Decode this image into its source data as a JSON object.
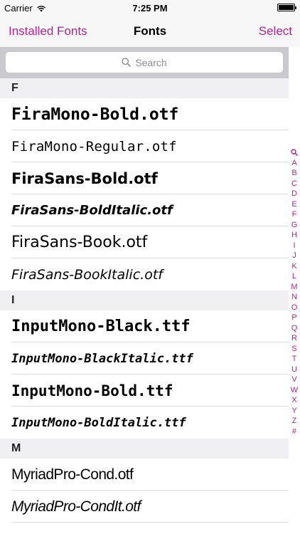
{
  "status_bar": {
    "carrier": "Carrier",
    "time": "7:25 PM"
  },
  "nav": {
    "back_label": "Installed Fonts",
    "title": "Fonts",
    "select_label": "Select"
  },
  "search": {
    "placeholder": "Search"
  },
  "colors": {
    "accent": "#b1258f",
    "section_bg": "#f0f0f2",
    "search_bar_bg": "#c9c9ce"
  },
  "sections": [
    {
      "letter": "F",
      "fonts": [
        "FiraMono-Bold.otf",
        "FiraMono-Regular.otf",
        "FiraSans-Bold.otf",
        "FiraSans-BoldItalic.otf",
        "FiraSans-Book.otf",
        "FiraSans-BookItalic.otf"
      ]
    },
    {
      "letter": "I",
      "fonts": [
        "InputMono-Black.ttf",
        "InputMono-BlackItalic.ttf",
        "InputMono-Bold.ttf",
        "InputMono-BoldItalic.ttf"
      ]
    },
    {
      "letter": "M",
      "fonts": [
        "MyriadPro-Cond.otf",
        "MyriadPro-CondIt.otf"
      ]
    }
  ],
  "index": [
    "A",
    "B",
    "C",
    "D",
    "E",
    "F",
    "G",
    "H",
    "I",
    "J",
    "K",
    "L",
    "M",
    "N",
    "O",
    "P",
    "Q",
    "R",
    "S",
    "T",
    "U",
    "V",
    "W",
    "X",
    "Y",
    "Z",
    "#"
  ]
}
